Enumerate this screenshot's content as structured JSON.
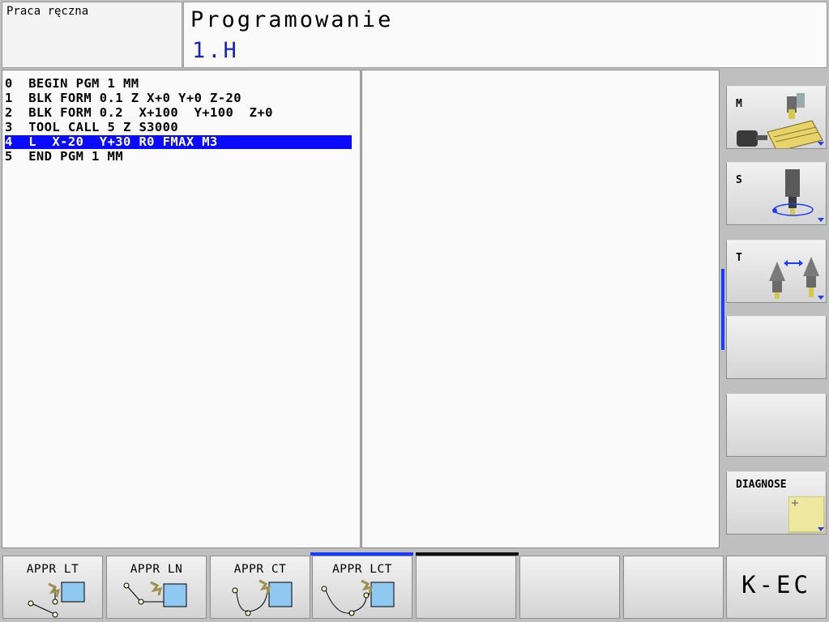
{
  "header": {
    "mode_manual": "Praca ręczna",
    "mode_program": "Programowanie",
    "program_name": "1.H"
  },
  "program": {
    "lines": [
      "0  BEGIN PGM 1 MM",
      "1  BLK FORM 0.1 Z X+0 Y+0 Z-20",
      "2  BLK FORM 0.2  X+100  Y+100  Z+0",
      "3  TOOL CALL 5 Z S3000",
      "4  L  X-20  Y+30 R0 FMAX M3",
      "5  END PGM 1 MM"
    ],
    "selected_index": 4
  },
  "side_softkeys": {
    "m": "M",
    "s": "S",
    "t": "T",
    "diagnose": "DIAGNOSE"
  },
  "bottom_softkeys": {
    "appr_lt": "APPR LT",
    "appr_ln": "APPR LN",
    "appr_ct": "APPR CT",
    "appr_lct": "APPR LCT",
    "k_ec": "K-EC"
  },
  "colors": {
    "selection": "#0a0aff",
    "accent_blue": "#1a3cff",
    "program_name": "#1a23c8"
  }
}
